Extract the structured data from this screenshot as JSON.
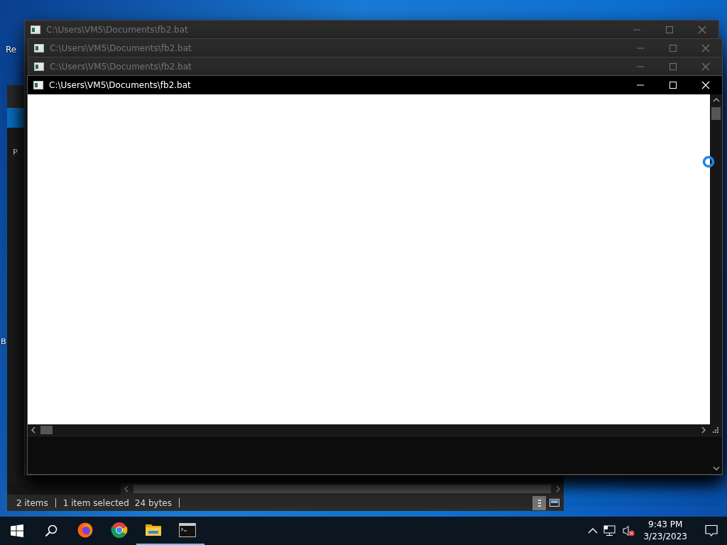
{
  "desktop": {
    "icon_labels": [
      {
        "label": "Re"
      },
      {
        "label": "B"
      }
    ]
  },
  "explorer": {
    "sidebar_label": "P",
    "status_bar": {
      "items": "2 items",
      "selected": "1 item selected",
      "size": "24 bytes"
    }
  },
  "console_windows": [
    {
      "title": "C:\\Users\\VM5\\Documents\\fb2.bat",
      "active": false
    },
    {
      "title": "C:\\Users\\VM5\\Documents\\fb2.bat",
      "active": false
    },
    {
      "title": "C:\\Users\\VM5\\Documents\\fb2.bat",
      "active": false
    },
    {
      "title": "C:\\Users\\VM5\\Documents\\fb2.bat",
      "active": true
    }
  ],
  "taskbar": {
    "apps": [
      {
        "kind": "firefox",
        "running": false
      },
      {
        "kind": "chrome",
        "running": false
      },
      {
        "kind": "folder",
        "running": true
      },
      {
        "kind": "console",
        "running": true
      }
    ],
    "clock": {
      "time": "9:43 PM",
      "date": "3/23/2023"
    }
  }
}
